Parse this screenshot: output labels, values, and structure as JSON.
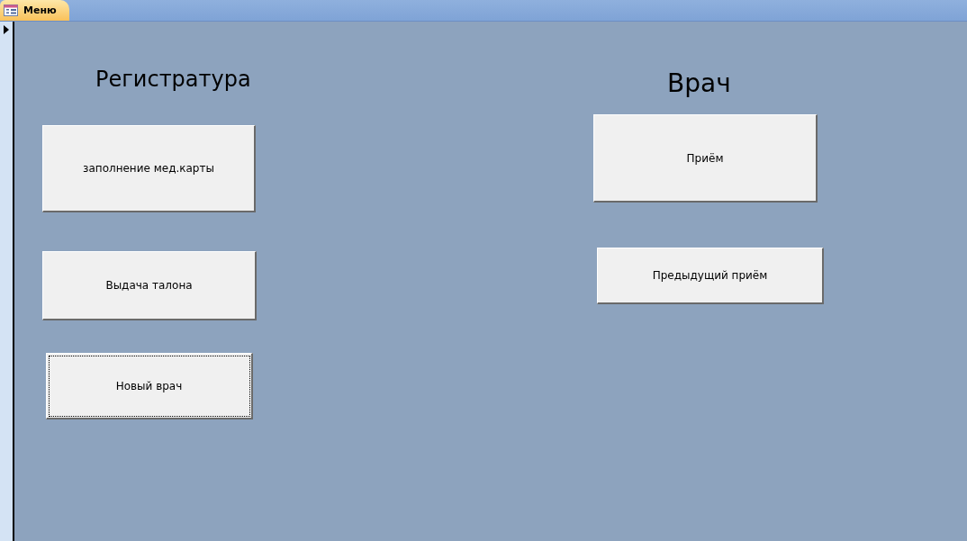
{
  "tab": {
    "title": "Меню",
    "selected": true
  },
  "sections": [
    {
      "heading": "Регистратура",
      "buttons": [
        {
          "label": "заполнение мед.карты",
          "focused": false
        },
        {
          "label": "Выдача талона",
          "focused": false
        },
        {
          "label": "Новый врач",
          "focused": true
        }
      ]
    },
    {
      "heading": "Врач",
      "buttons": [
        {
          "label": "Приём",
          "focused": false
        },
        {
          "label": "Предыдущий приём",
          "focused": false
        }
      ]
    }
  ]
}
